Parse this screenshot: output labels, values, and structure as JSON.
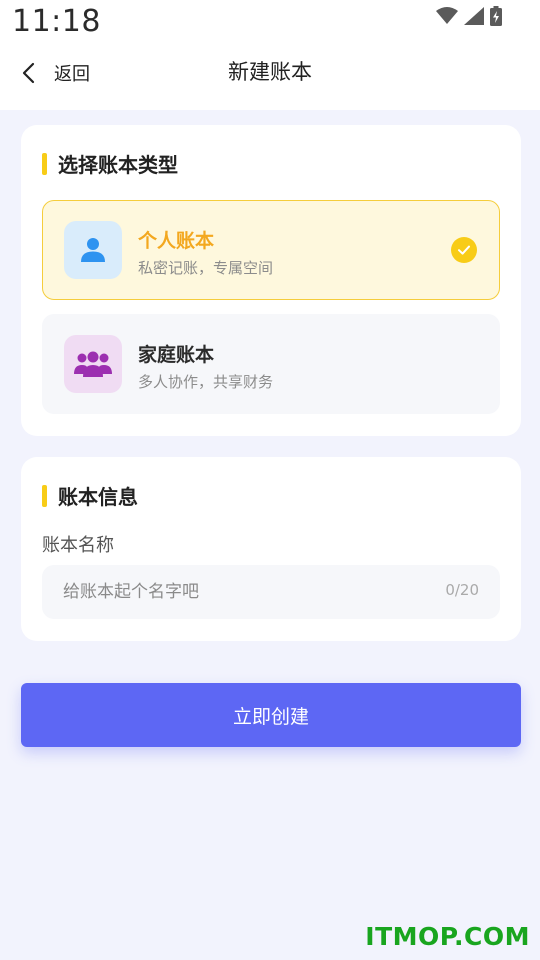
{
  "status_bar": {
    "time": "11:18",
    "icons": [
      "wifi-icon",
      "signal-icon",
      "battery-charging-icon"
    ]
  },
  "header": {
    "back_label": "返回",
    "title": "新建账本"
  },
  "type_section": {
    "title": "选择账本类型",
    "options": [
      {
        "title": "个人账本",
        "desc": "私密记账，专属空间",
        "icon": "person-icon",
        "selected": true
      },
      {
        "title": "家庭账本",
        "desc": "多人协作，共享财务",
        "icon": "group-icon",
        "selected": false
      }
    ]
  },
  "info_section": {
    "title": "账本信息",
    "name_label": "账本名称",
    "name_value": "",
    "name_placeholder": "给账本起个名字吧",
    "counter": "0/20"
  },
  "create_button": "立即创建",
  "watermark": "ITMOP.COM",
  "colors": {
    "accent_yellow": "#f8cc17",
    "selected_title": "#f3a81f",
    "primary_button": "#5d67f4",
    "page_background": "#f2f3fd",
    "person_icon": "#2e93f0",
    "group_icon": "#9c2fb0",
    "watermark": "#19a51f"
  }
}
